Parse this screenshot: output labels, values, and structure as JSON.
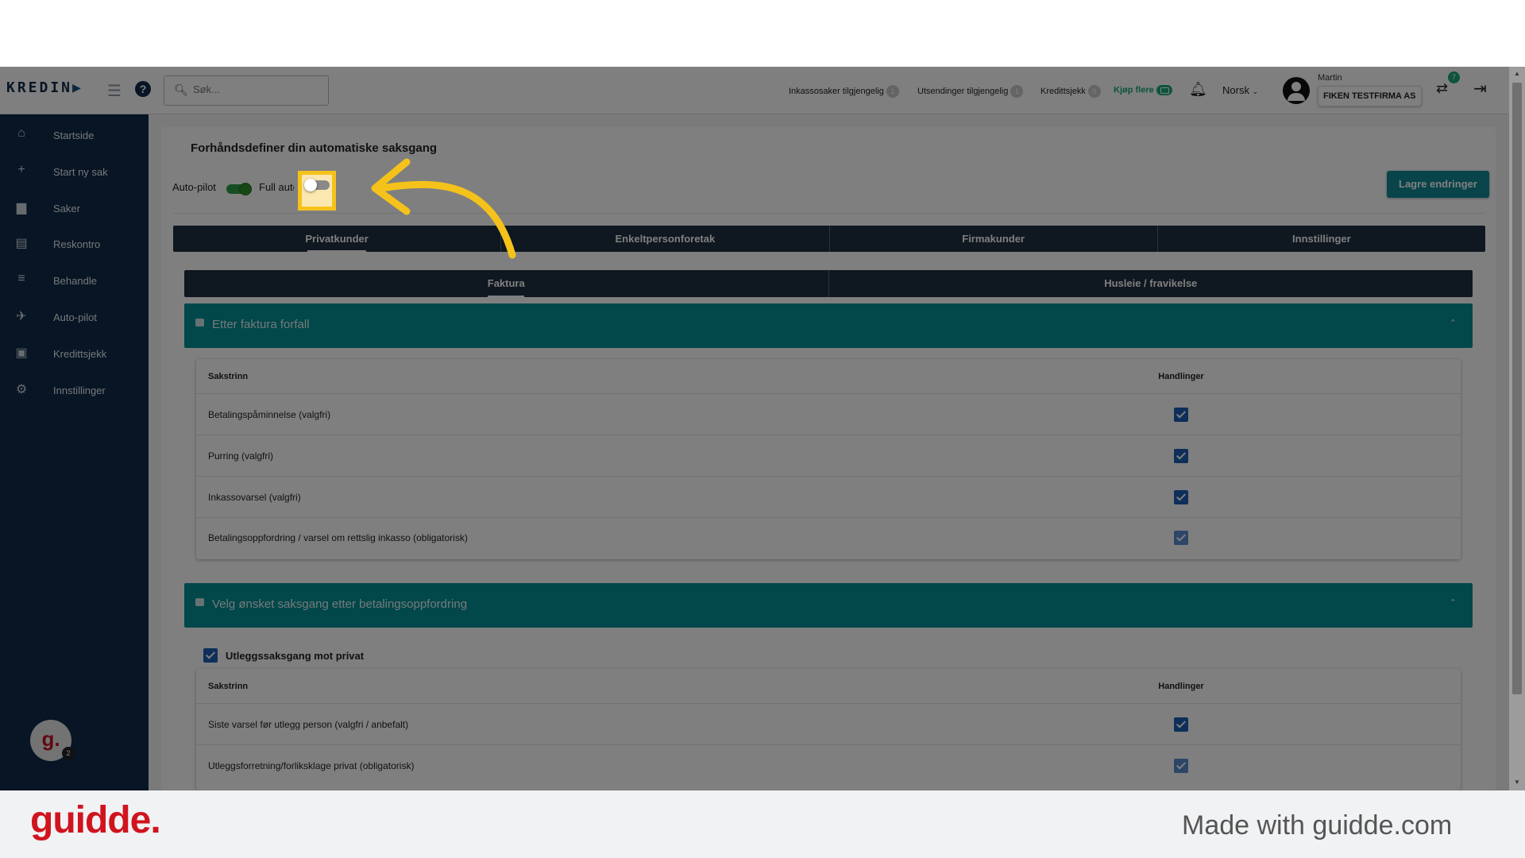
{
  "header": {
    "logo_text": "KREDIN",
    "search_placeholder": "Søk...",
    "stats": [
      {
        "label": "Inkassosaker tilgjengelig",
        "count": "1"
      },
      {
        "label": "Utsendinger tilgjengelig",
        "count": "1"
      },
      {
        "label": "Kredittsjekk",
        "count": "0"
      }
    ],
    "buy_more": "Kjøp flere",
    "language": "Norsk",
    "user_name": "Martin",
    "company": "FIKEN TESTFIRMA AS",
    "notification_count": "7"
  },
  "sidebar": {
    "items": [
      {
        "label": "Startside",
        "icon": "home-icon",
        "glyph": "⌂"
      },
      {
        "label": "Start ny sak",
        "icon": "plus-icon",
        "glyph": "+"
      },
      {
        "label": "Saker",
        "icon": "briefcase-icon",
        "glyph": "▆"
      },
      {
        "label": "Reskontro",
        "icon": "document-icon",
        "glyph": "▤"
      },
      {
        "label": "Behandle",
        "icon": "process-list-icon",
        "glyph": "≡"
      },
      {
        "label": "Auto-pilot",
        "icon": "airplane-icon",
        "glyph": "✈"
      },
      {
        "label": "Kredittsjekk",
        "icon": "credit-check-icon",
        "glyph": "▣"
      },
      {
        "label": "Innstillinger",
        "icon": "gear-icon",
        "glyph": "⚙"
      }
    ],
    "avatar_letter": "g.",
    "avatar_badge": "2"
  },
  "main": {
    "title": "Forhåndsdefiner din automatiske saksgang",
    "autopilot_label": "Auto-pilot",
    "full_auto_label": "Full automatikk",
    "autopilot_on": true,
    "full_auto_on": false,
    "save_label": "Lagre endringer",
    "tabs": [
      "Privatkunder",
      "Enkeltpersonforetak",
      "Firmakunder",
      "Innstillinger"
    ],
    "subtabs": [
      "Faktura",
      "Husleie / fravikelse"
    ],
    "section1": {
      "title": "Etter faktura forfall",
      "col_step": "Sakstrinn",
      "col_actions": "Handlinger",
      "rows": [
        "Betalingspåminnelse (valgfri)",
        "Purring (valgfri)",
        "Inkassovarsel (valgfri)",
        "Betalingsoppfordring / varsel om rettslig inkasso (obligatorisk)"
      ]
    },
    "section2": {
      "title": "Velg ønsket saksgang etter betalingsoppfordring",
      "checkbox_label": "Utleggssaksgang mot privat",
      "col_step": "Sakstrinn",
      "col_actions": "Handlinger",
      "rows": [
        "Siste varsel før utlegg person (valgfri / anbefalt)",
        "Utleggsforretning/forliksklage privat (obligatorisk)"
      ]
    }
  },
  "footer": {
    "brand": "guidde.",
    "made_with": "Made with guidde.com"
  },
  "colors": {
    "sidebar": "#0e2b48",
    "teal": "#058f95",
    "highlight": "#f5c21b",
    "brand": "#d0141e"
  }
}
